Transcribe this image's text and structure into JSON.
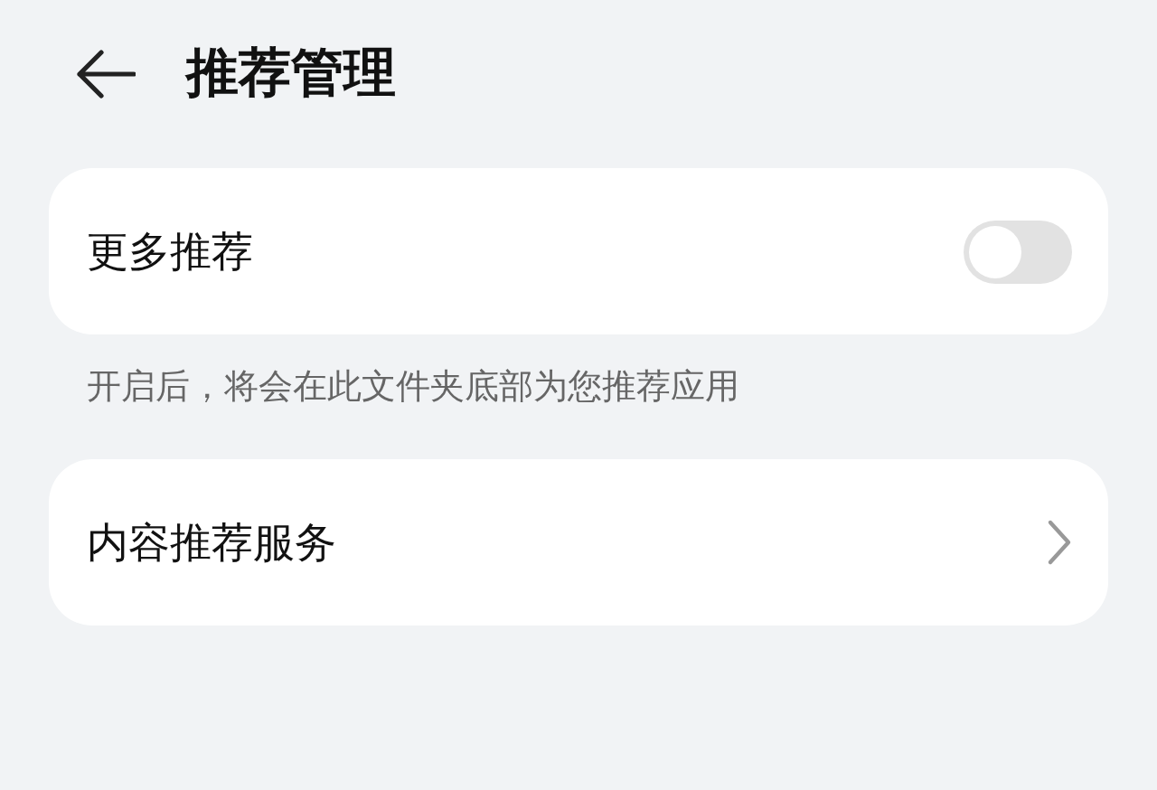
{
  "header": {
    "title": "推荐管理"
  },
  "toggle_card": {
    "label": "更多推荐",
    "on": false
  },
  "caption": "开启后，将会在此文件夹底部为您推荐应用",
  "link_card": {
    "label": "内容推荐服务"
  }
}
